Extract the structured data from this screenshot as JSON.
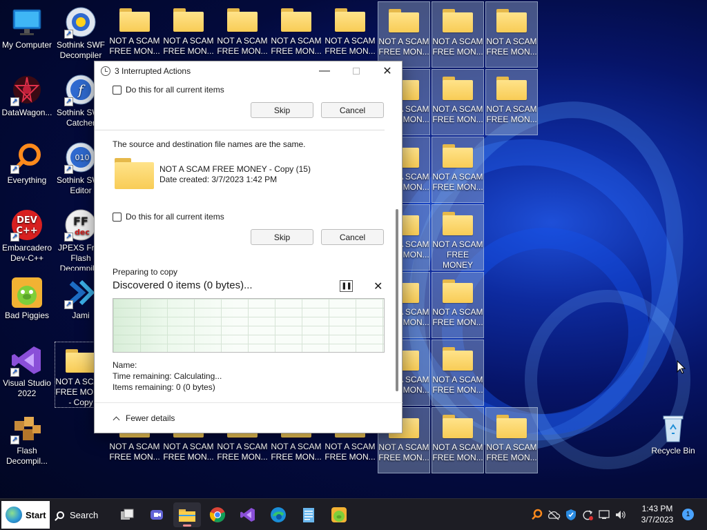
{
  "desktop": {
    "left_icons": [
      {
        "label": "My Computer",
        "icon": "computer-icon"
      },
      {
        "label": "Sothink SWF Decompiler",
        "icon": "sothink-decompiler-icon"
      },
      {
        "label": "DataWagon...",
        "icon": "datawagon-icon"
      },
      {
        "label": "Sothink SWF Catcher",
        "icon": "sothink-catcher-icon"
      },
      {
        "label": "Everything",
        "icon": "everything-search-icon"
      },
      {
        "label": "Sothink SWF Editor",
        "icon": "sothink-editor-icon"
      },
      {
        "label": "Embarcadero Dev-C++",
        "icon": "devcpp-icon"
      },
      {
        "label": "JPEXS Free Flash Decompiler",
        "icon": "jpexs-icon"
      },
      {
        "label": "Bad Piggies",
        "icon": "bad-piggies-icon"
      },
      {
        "label": "Jami",
        "icon": "jami-icon"
      },
      {
        "label": "Visual Studio 2022",
        "icon": "visual-studio-icon"
      },
      {
        "label": "NOT A SCAM FREE MON... - Copy",
        "icon": "folder-icon"
      },
      {
        "label": "Flash Decompil...",
        "icon": "flash-decompiler-icon"
      }
    ],
    "folder_label_short": "NOT A SCAM FREE MON...",
    "folder_label_full": "NOT A SCAM FREE MONEY",
    "folder_label_partial": "SCAM MON...",
    "recycle_bin": "Recycle Bin"
  },
  "dialog": {
    "title": "3 Interrupted Actions",
    "checkbox_label": "Do this for all current items",
    "skip_label": "Skip",
    "cancel_label": "Cancel",
    "conflict_message": "The source and destination file names are the same.",
    "file_name": "NOT A SCAM FREE MONEY - Copy (15)",
    "file_date": "Date created: 3/7/2023 1:42 PM",
    "progress": {
      "status": "Preparing to copy",
      "discovered": "Discovered 0 items (0 bytes)...",
      "name_label": "Name:",
      "time_remaining": "Time remaining:  Calculating...",
      "items_remaining": "Items remaining:  0 (0 bytes)"
    },
    "fewer_details": "Fewer details"
  },
  "taskbar": {
    "start_label": "Start",
    "search_label": "Search",
    "apps": [
      "task-view-icon",
      "teams-chat-icon",
      "file-explorer-icon",
      "chrome-icon",
      "visual-studio-icon",
      "edge-icon",
      "notepad-icon",
      "bad-piggies-icon"
    ],
    "time": "1:43 PM",
    "date": "3/7/2023",
    "notification_count": "1"
  }
}
